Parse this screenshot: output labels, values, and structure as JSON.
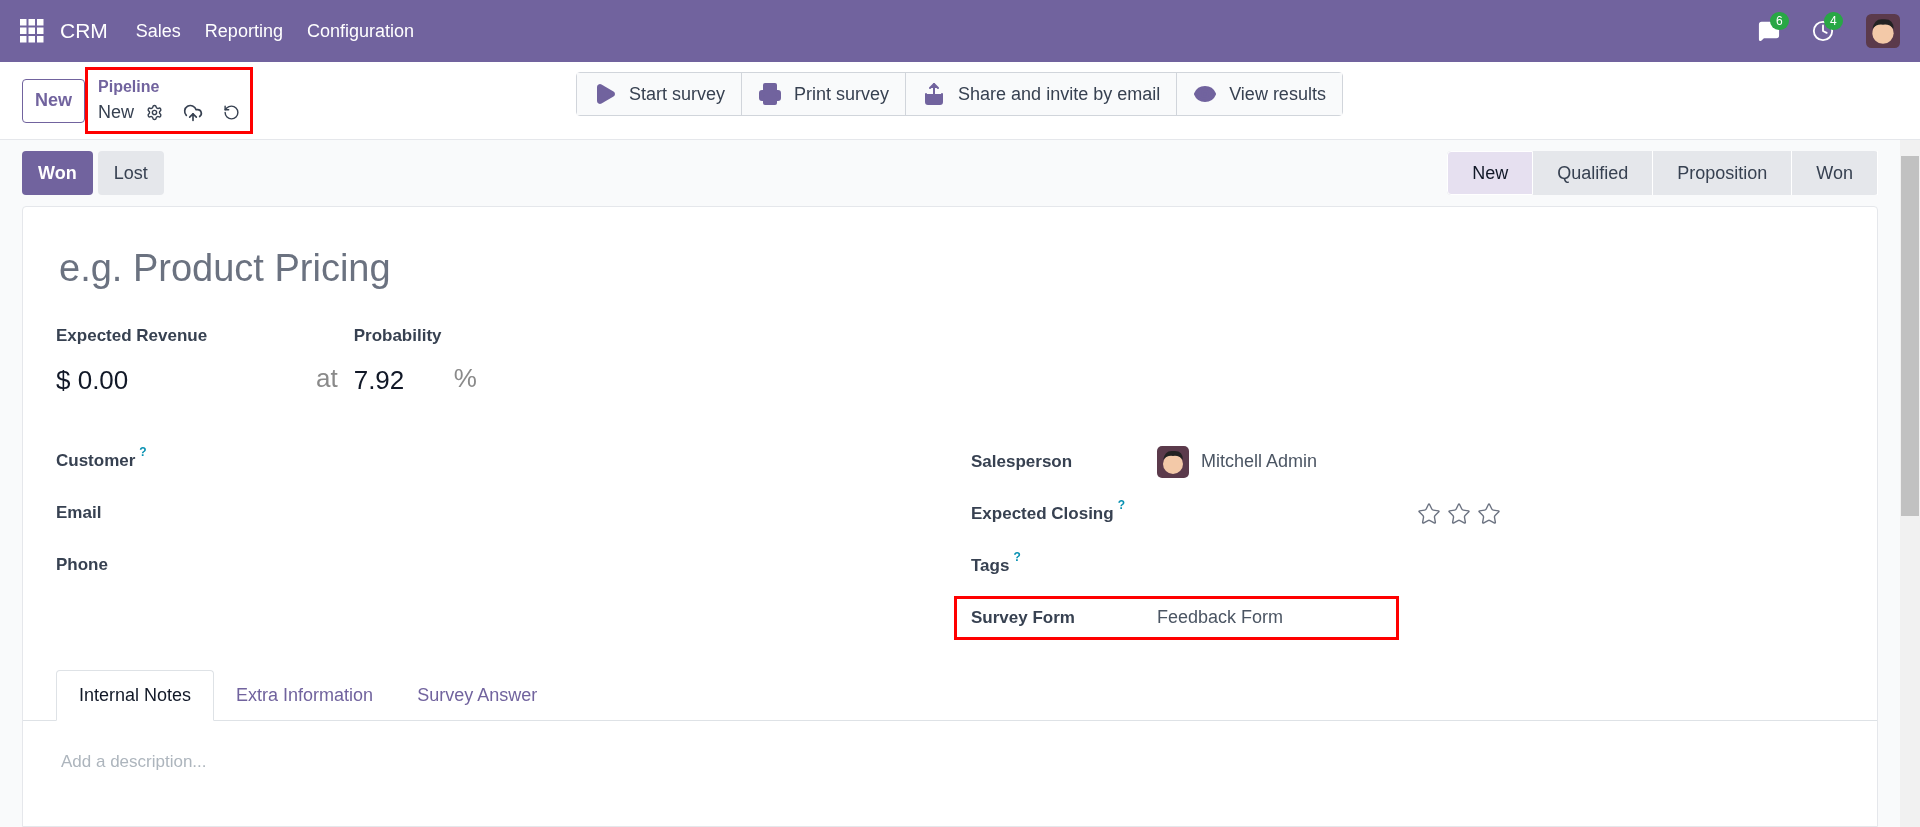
{
  "navbar": {
    "app": "CRM",
    "menus": [
      "Sales",
      "Reporting",
      "Configuration"
    ],
    "messages_count": "6",
    "activities_count": "4"
  },
  "control_panel": {
    "new_button": "New",
    "breadcrumb": "Pipeline",
    "record": "New",
    "actions": [
      "Start survey",
      "Print survey",
      "Share and invite by email",
      "View results"
    ]
  },
  "status_buttons": [
    {
      "label": "Won",
      "kind": "primary"
    },
    {
      "label": "Lost",
      "kind": "secondary"
    }
  ],
  "stages": [
    {
      "label": "New",
      "selected": true
    },
    {
      "label": "Qualified",
      "selected": false
    },
    {
      "label": "Proposition",
      "selected": false
    },
    {
      "label": "Won",
      "selected": false
    }
  ],
  "form": {
    "title_placeholder": "e.g. Product Pricing",
    "revenue_label": "Expected Revenue",
    "revenue": "$ 0.00",
    "at": "at",
    "probability_label": "Probability",
    "probability": "7.92",
    "percent": "%",
    "left_fields": [
      {
        "label": "Customer",
        "help": "?"
      },
      {
        "label": "Email"
      },
      {
        "label": "Phone"
      }
    ],
    "right_fields": [
      {
        "label": "Salesperson",
        "kind": "user",
        "value": "Mitchell Admin"
      },
      {
        "label": "Expected Closing",
        "help": "?",
        "kind": "stars",
        "stars": 0
      },
      {
        "label": "Tags",
        "help": "?",
        "kind": "empty"
      },
      {
        "label": "Survey Form",
        "kind": "text",
        "value": "Feedback Form",
        "highlighted": true
      }
    ]
  },
  "notebook": {
    "tabs": [
      {
        "label": "Internal Notes",
        "selected": true
      },
      {
        "label": "Extra Information",
        "selected": false
      },
      {
        "label": "Survey Answer",
        "selected": false
      }
    ],
    "description_placeholder": "Add a description..."
  }
}
